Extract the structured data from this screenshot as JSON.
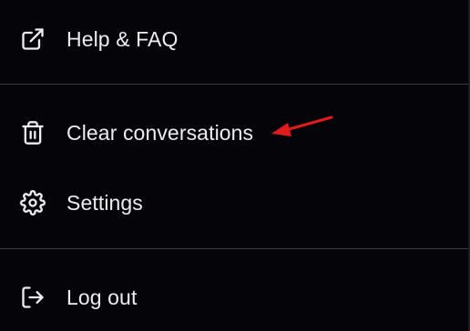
{
  "menu": {
    "items": [
      {
        "label": "Help & FAQ",
        "icon": "external-link-icon"
      },
      {
        "label": "Clear conversations",
        "icon": "trash-icon"
      },
      {
        "label": "Settings",
        "icon": "gear-icon"
      },
      {
        "label": "Log out",
        "icon": "log-out-icon"
      }
    ]
  },
  "colors": {
    "background": "#050509",
    "text": "#ececf1",
    "divider": "#3a3a40",
    "annotation": "#e01b1b"
  }
}
